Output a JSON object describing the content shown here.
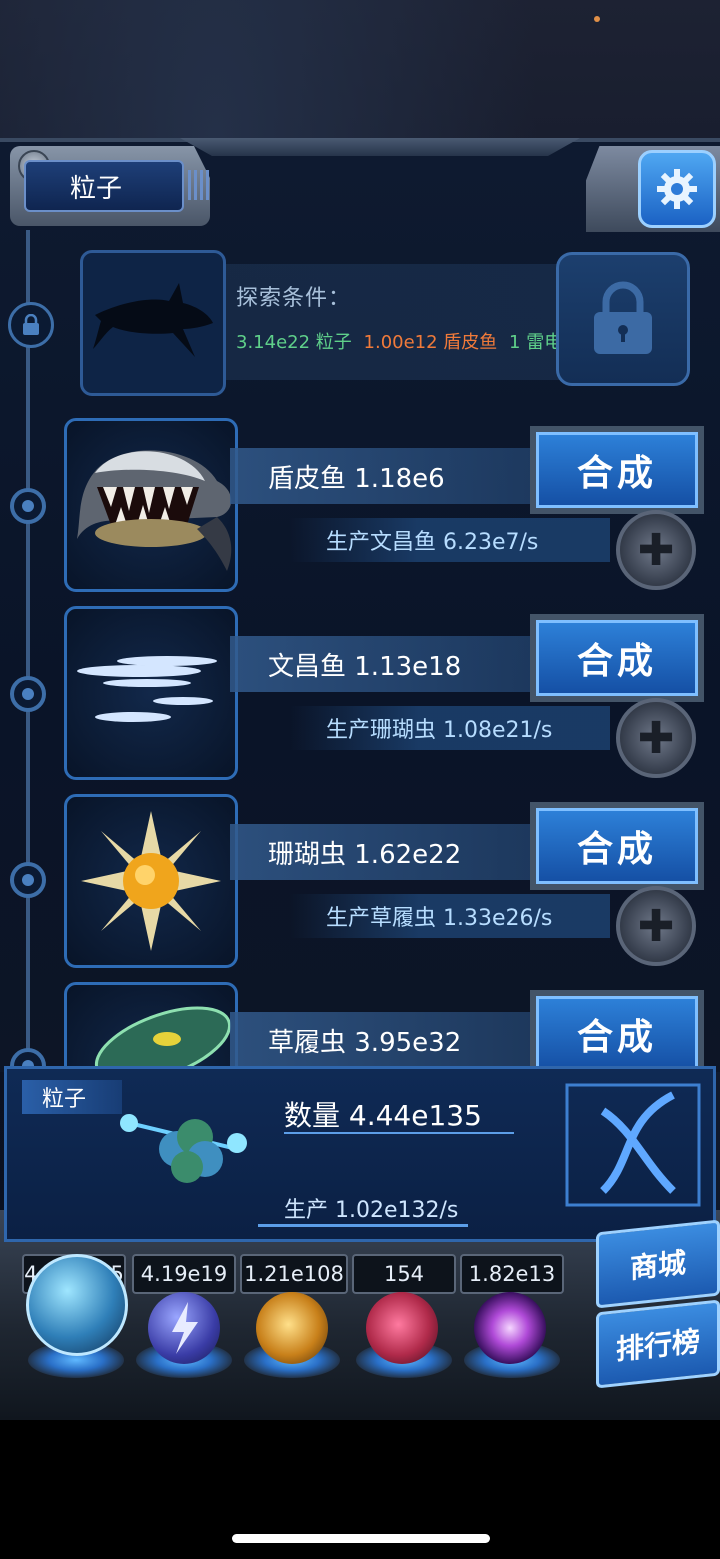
{
  "header": {
    "title": "粒子"
  },
  "locked": {
    "title": "探索条件：",
    "requirements": [
      {
        "text": "3.14e22 粒子",
        "color": "#5fd08a"
      },
      {
        "text": "1.00e12 盾皮鱼",
        "color": "#f07a3a"
      },
      {
        "text": "1 雷电",
        "color": "#5fd08a"
      }
    ]
  },
  "creatures": [
    {
      "name": "盾皮鱼 1.18e6",
      "production": "生产文昌鱼 6.23e7/s",
      "action": "合成"
    },
    {
      "name": "文昌鱼 1.13e18",
      "production": "生产珊瑚虫 1.08e21/s",
      "action": "合成"
    },
    {
      "name": "珊瑚虫 1.62e22",
      "production": "生产草履虫 1.33e26/s",
      "action": "合成"
    },
    {
      "name": "草履虫 3.95e32",
      "production": "",
      "action": "合成"
    }
  ],
  "resource": {
    "tag": "粒子",
    "count": "数量 4.44e135",
    "production": "生产 1.02e132/s"
  },
  "dock": {
    "counts": [
      "4.44e135",
      "4.19e19",
      "1.21e108",
      "154",
      "1.82e13"
    ],
    "shop": "商城",
    "rank": "排行榜"
  },
  "colors": {
    "accent": "#2d80d8",
    "panel": "#0b1a33"
  },
  "icons": [
    "gear-icon",
    "lock-icon",
    "plus-icon"
  ]
}
